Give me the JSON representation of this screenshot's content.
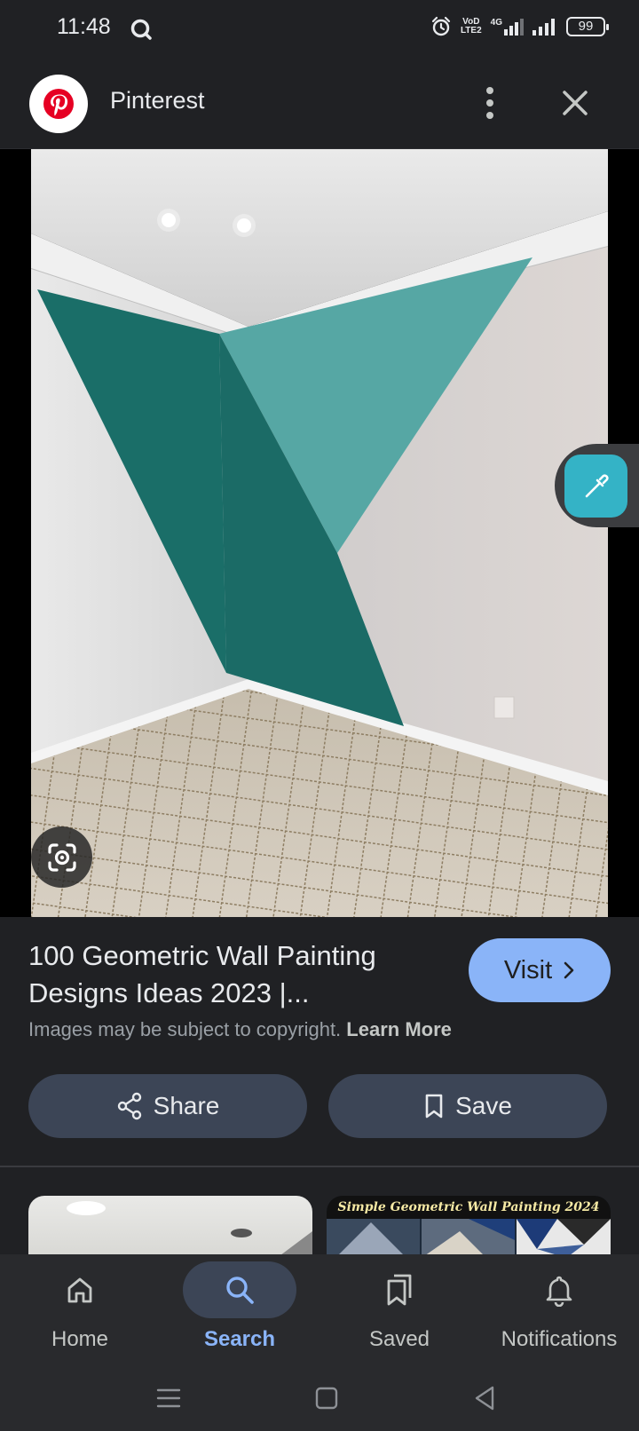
{
  "status_bar": {
    "time": "11:48",
    "network_top": "VoD",
    "network_bottom": "LTE2",
    "network_type": "4G",
    "battery": "99"
  },
  "header": {
    "site_name": "Pinterest",
    "logo_icon": "pinterest-logo-icon",
    "more_icon": "more-vert-icon",
    "close_icon": "close-icon"
  },
  "image": {
    "lens_icon": "google-lens-icon",
    "edit_icon": "eyedropper-icon"
  },
  "result": {
    "title": "100 Geometric Wall Painting Designs Ideas 2023 |...",
    "visit_label": "Visit",
    "copyright_text": "Images may be subject to copyright.",
    "learn_more": "Learn More",
    "share_label": "Share",
    "save_label": "Save"
  },
  "related": {
    "right_caption": "Simple Geometric Wall Painting 2024"
  },
  "bottom_nav": {
    "items": [
      {
        "label": "Home",
        "icon": "home-icon"
      },
      {
        "label": "Search",
        "icon": "search-icon",
        "active": true
      },
      {
        "label": "Saved",
        "icon": "bookmarks-icon"
      },
      {
        "label": "Notifications",
        "icon": "bell-icon"
      }
    ]
  },
  "colors": {
    "background": "#202124",
    "accent": "#8ab4f8",
    "button": "#3c4556",
    "teal_dark": "#1a6e68",
    "teal_light": "#56a7a4"
  }
}
